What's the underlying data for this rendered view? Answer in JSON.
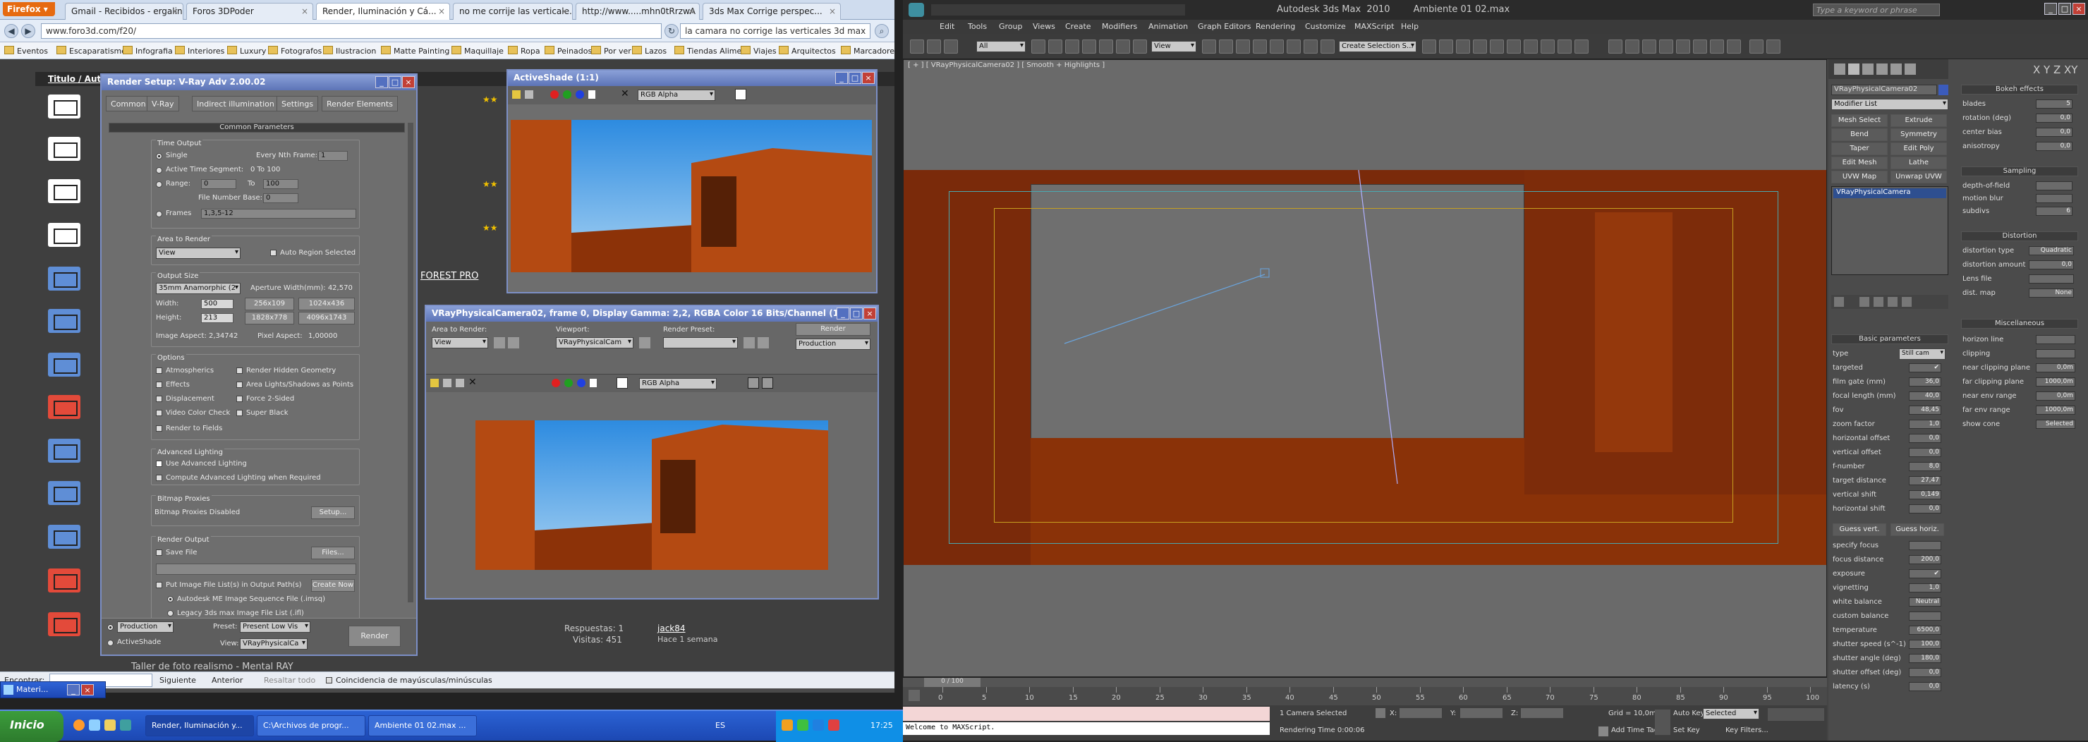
{
  "firefox": {
    "menu_button": "Firefox ▾",
    "tabs": [
      {
        "label": "Gmail - Recibidos - ergalin..."
      },
      {
        "label": "Foros 3DPoder"
      },
      {
        "label": "Render, Iluminación y Cá..."
      },
      {
        "label": "no me corrije las verticale..."
      },
      {
        "label": "http://www.....mhn0tRrzwA"
      },
      {
        "label": "3ds Max Corrige perspec..."
      }
    ],
    "url": "www.foro3d.com/f20/",
    "search": "la camara no corrige las verticales 3d max",
    "bookmarks": [
      "Eventos",
      "Escaparatismo",
      "Infografia",
      "Interiores",
      "Luxury",
      "Fotografos",
      "Ilustracion",
      "Matte Painting",
      "Maquillaje",
      "Ropa",
      "Peinados",
      "Por ver",
      "Lazos",
      "Tiendas Aliment",
      "Viajes",
      "Arquitectos",
      "Marcadores"
    ],
    "page": {
      "title_col": "Titulo / Aut",
      "forest_link": "FOREST PRO",
      "respuestas": "Respuestas: 1",
      "visitas": "Visitas: 451",
      "user": "jack84",
      "when": "Hace 1 semana",
      "thread_bottom": "Taller de foto realismo - Mental RAY"
    },
    "findbar": {
      "label": "Encontrar:",
      "next": "Siguiente",
      "prev": "Anterior",
      "highlight": "Resaltar todo",
      "match_case": "Coincidencia de mayúsculas/minúsculas"
    }
  },
  "render_setup": {
    "title": "Render Setup: V-Ray Adv 2.00.02",
    "tabs": [
      "Common",
      "V-Ray",
      "Indirect illumination",
      "Settings",
      "Render Elements"
    ],
    "rollout": "Common Parameters",
    "time_output": {
      "label": "Time Output",
      "single": "Single",
      "every_nth": "Every Nth Frame:",
      "every_nth_value": "1",
      "active_segment": "Active Time Segment:",
      "active_range": "0 To 100",
      "range": "Range:",
      "range_from": "0",
      "to": "To",
      "range_to": "100",
      "file_number_base": "File Number Base:",
      "file_number_value": "0",
      "frames": "Frames",
      "frames_value": "1,3,5-12"
    },
    "area_to_render": {
      "label": "Area to Render",
      "value": "View",
      "auto_region": "Auto Region Selected"
    },
    "output_size": {
      "label": "Output Size",
      "preset": "35mm Anamorphic (2",
      "aperture": "Aperture Width(mm): 42,570",
      "width_label": "Width:",
      "width": "500",
      "height_label": "Height:",
      "height": "213",
      "presets": [
        "256x109",
        "1024x436",
        "1828x778",
        "4096x1743"
      ],
      "image_aspect": "Image Aspect: 2,34742",
      "pixel_aspect": "Pixel Aspect:",
      "pixel_aspect_value": "1,00000"
    },
    "options": {
      "label": "Options",
      "items": [
        "Atmospherics",
        "Render Hidden Geometry",
        "Effects",
        "Area Lights/Shadows as Points",
        "Displacement",
        "Force 2-Sided",
        "Video Color Check",
        "Super Black",
        "Render to Fields"
      ]
    },
    "advanced_lighting": {
      "label": "Advanced Lighting",
      "use": "Use Advanced Lighting",
      "compute": "Compute Advanced Lighting when Required"
    },
    "bitmap_proxies": {
      "label": "Bitmap Proxies",
      "status": "Bitmap Proxies Disabled",
      "setup": "Setup..."
    },
    "render_output": {
      "label": "Render Output",
      "save_file": "Save File",
      "files": "Files...",
      "put_image": "Put Image File List(s) in Output Path(s)",
      "create_now": "Create Now",
      "autodesk_seq": "Autodesk ME Image Sequence File (.imsq)",
      "legacy": "Legacy 3ds max Image File List (.ifl)"
    },
    "bottom": {
      "production": "Production",
      "activeshade": "ActiveShade",
      "preset_label": "Preset:",
      "preset_value": "Present Low Vis",
      "view_label": "View:",
      "view_value": "VRayPhysicalCa",
      "render": "Render"
    }
  },
  "activeshade": {
    "title": "ActiveShade (1:1)",
    "channel": "RGB Alpha"
  },
  "frame_window": {
    "title": "VRayPhysicalCamera02, frame 0, Display Gamma: 2,2, RGBA Color 16 Bits/Channel (1...",
    "area_label": "Area to Render:",
    "area_value": "View",
    "viewport_label": "Viewport:",
    "viewport_value": "VRayPhysicalCam",
    "preset_label": "Render Preset:",
    "preset_value": "",
    "render": "Render",
    "mode": "Production",
    "channel": "RGB Alpha"
  },
  "max": {
    "title": "Autodesk 3ds Max  2010        Ambiente 01 02.max",
    "search_placeholder": "Type a keyword or phrase",
    "menu": [
      "Edit",
      "Tools",
      "Group",
      "Views",
      "Create",
      "Modifiers",
      "Animation",
      "Graph Editors",
      "Rendering",
      "Customize",
      "MAXScript",
      "Help"
    ],
    "toolbar_dropdowns": {
      "selection": "All",
      "view": "View",
      "named_sel": "Create Selection S..."
    },
    "viewport_label": "[ + ] [ VRayPhysicalCamera02 ] [ Smooth + Highlights ]",
    "modifier": {
      "object_name": "VRayPhysicalCamera02",
      "modifier_list": "Modifier List",
      "buttons": [
        "Mesh Select",
        "Extrude",
        "Bend",
        "Symmetry",
        "Taper",
        "Edit Poly",
        "Edit Mesh",
        "Lathe",
        "UVW Map",
        "Unwrap UVW"
      ],
      "stack_item": "VRayPhysicalCamera"
    },
    "basic_params": {
      "header": "Basic parameters",
      "type_label": "type",
      "type_value": "Still cam",
      "rows": [
        {
          "label": "targeted",
          "value": "✔"
        },
        {
          "label": "film gate (mm)",
          "value": "36,0"
        },
        {
          "label": "focal length (mm)",
          "value": "40,0"
        },
        {
          "label": "fov",
          "value": "48,45"
        },
        {
          "label": "zoom factor",
          "value": "1,0"
        },
        {
          "label": "horizontal offset",
          "value": "0,0"
        },
        {
          "label": "vertical offset",
          "value": "0,0"
        },
        {
          "label": "f-number",
          "value": "8,0"
        },
        {
          "label": "target distance",
          "value": "27,47"
        },
        {
          "label": "vertical shift",
          "value": "0,149"
        },
        {
          "label": "horizontal shift",
          "value": "0,0"
        }
      ],
      "guess_vert": "Guess vert.",
      "guess_horiz": "Guess horiz.",
      "rows2": [
        {
          "label": "specify focus",
          "value": ""
        },
        {
          "label": "focus distance",
          "value": "200,0"
        },
        {
          "label": "exposure",
          "value": "✔"
        },
        {
          "label": "vignetting",
          "value": "1,0"
        },
        {
          "label": "white balance",
          "value": "Neutral"
        },
        {
          "label": "custom balance",
          "value": ""
        },
        {
          "label": "temperature",
          "value": "6500,0"
        },
        {
          "label": "shutter speed (s^-1)",
          "value": "100,0"
        },
        {
          "label": "shutter angle (deg)",
          "value": "180,0"
        },
        {
          "label": "shutter offset (deg)",
          "value": "0,0"
        },
        {
          "label": "latency (s)",
          "value": "0,0"
        }
      ]
    },
    "right_panel": {
      "bokeh": "Bokeh effects",
      "bokeh_rows": [
        {
          "label": "blades",
          "value": "5"
        },
        {
          "label": "rotation (deg)",
          "value": "0,0"
        },
        {
          "label": "center bias",
          "value": "0,0"
        },
        {
          "label": "anisotropy",
          "value": "0,0"
        }
      ],
      "sampling": "Sampling",
      "sampling_rows": [
        {
          "label": "depth-of-field",
          "value": ""
        },
        {
          "label": "motion blur",
          "value": ""
        },
        {
          "label": "subdivs",
          "value": "6"
        }
      ],
      "distortion": "Distortion",
      "distortion_rows": [
        {
          "label": "distortion type",
          "value": "Quadratic"
        },
        {
          "label": "distortion amount",
          "value": "0,0"
        },
        {
          "label": "Lens file",
          "value": ""
        },
        {
          "label": "dist. map",
          "value": "None"
        }
      ],
      "misc": "Miscellaneous",
      "misc_rows": [
        {
          "label": "horizon line",
          "value": ""
        },
        {
          "label": "clipping",
          "value": ""
        },
        {
          "label": "near clipping plane",
          "value": "0,0m"
        },
        {
          "label": "far clipping plane",
          "value": "1000,0m"
        },
        {
          "label": "near env range",
          "value": "0,0m"
        },
        {
          "label": "far env range",
          "value": "1000,0m"
        },
        {
          "label": "show cone",
          "value": "Selected"
        }
      ]
    },
    "timeline": {
      "frame_display": "0 / 100",
      "ticks": [
        "0",
        "5",
        "10",
        "15",
        "20",
        "25",
        "30",
        "35",
        "40",
        "45",
        "50",
        "55",
        "60",
        "65",
        "70",
        "75",
        "80",
        "85",
        "90",
        "95",
        "100"
      ]
    },
    "status": {
      "maxscript": "Welcome to MAXScript.",
      "selected": "1 Camera Selected",
      "rendering_time": "Rendering Time  0:00:06",
      "x_label": "X:",
      "y_label": "Y:",
      "z_label": "Z:",
      "grid": "Grid = 10,0m",
      "auto_key": "Auto Key",
      "set_key": "Set Key",
      "selected_mode": "Selected",
      "key_filters": "Key Filters...",
      "add_time_tag": "Add Time Tag"
    }
  },
  "taskbar": {
    "start": "Inicio",
    "material_title": "Materi...",
    "tasks": [
      {
        "label": "Render, Iluminación y..."
      },
      {
        "label": "C:\\Archivos de progr..."
      },
      {
        "label": "Ambiente 01 02.max ..."
      }
    ],
    "lang": "ES",
    "time": "17:25"
  }
}
